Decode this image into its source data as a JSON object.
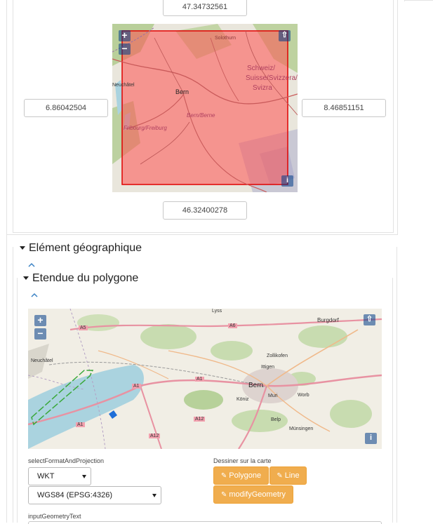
{
  "bbox": {
    "north": "47.34732561",
    "west": "6.86042504",
    "east": "8.46851151",
    "south": "46.32400278"
  },
  "map1": {
    "zoom_in": "+",
    "zoom_out": "−",
    "fullscreen": "⇧",
    "info": "i",
    "labels": {
      "solothurn": "Solothurn",
      "schweiz1": "Schweiz/",
      "schweiz2": "Suisse/Svizzera/",
      "schweiz3": "Svizra",
      "neuchatel": "Neuchâtel",
      "bern": "Bern",
      "bern_berne": "Bern/Berne",
      "fribourg": "Fribourg/Freiburg"
    }
  },
  "sections": {
    "geo_element": "Elément géographique",
    "polygon_extent": "Etendue du polygone"
  },
  "map2": {
    "zoom_in": "+",
    "zoom_out": "−",
    "fullscreen": "⇧",
    "info": "i",
    "labels": {
      "lyss": "Lyss",
      "burgdorf": "Burgdorf",
      "neuchatel": "Neuchâtel",
      "zollikofen": "Zollikofen",
      "ittigen": "Ittigen",
      "bern": "Bern",
      "koniz": "Köniz",
      "muri": "Muri",
      "worb": "Worb",
      "belp": "Belp",
      "munsingen": "Münsingen",
      "a5": "A5",
      "a6": "A6",
      "a1a": "A1",
      "a1b": "A1",
      "a1c": "A1",
      "a12a": "A12",
      "a12b": "A12"
    }
  },
  "form": {
    "select_format_label": "selectFormatAndProjection",
    "format_value": "WKT",
    "projection_value": "WGS84 (EPSG:4326)",
    "draw_label": "Dessiner sur la carte",
    "polygon_button": "Polygone",
    "line_button": "Line",
    "modify_button": "modifyGeometry",
    "input_geometry_label": "inputGeometryText"
  }
}
